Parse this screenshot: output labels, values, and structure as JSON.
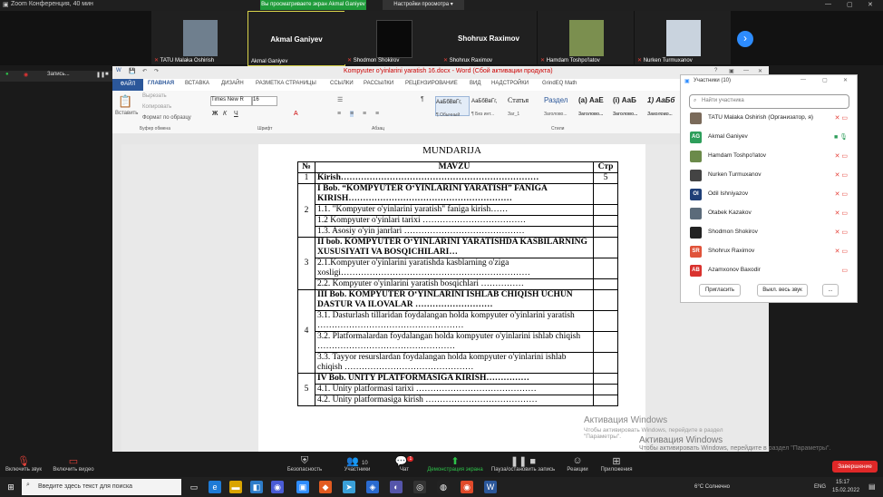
{
  "zoom": {
    "title": "Zoom Конференция, 40 мин",
    "view_banner": "Вы просматриваете экран Akmal Ganiyev",
    "view_settings": "Настройки просмотра ▾",
    "recording_label": "Запись...",
    "tiles": [
      {
        "mini_name": "TATU Malaka Oshirish",
        "big_name": ""
      },
      {
        "mini_name": "Akmal Ganiyev",
        "big_name": "Akmal Ganiyev"
      },
      {
        "mini_name": "Shodmon Shokirov",
        "big_name": ""
      },
      {
        "mini_name": "Shohrux Raximov",
        "big_name": "Shohrux Raximov"
      },
      {
        "mini_name": "Hamdam Toshpo'latov",
        "big_name": ""
      },
      {
        "mini_name": "Nurken Turmuxanov",
        "big_name": ""
      }
    ],
    "toolbar": {
      "audio": "Включить звук",
      "video": "Включить видео",
      "security": "Безопасность",
      "participants": "Участники",
      "participants_count": "10",
      "chat": "Чат",
      "chat_badge": "1",
      "share": "Демонстрация экрана",
      "pause_rec": "Пауза/остановить запись",
      "reactions": "Реакции",
      "apps": "Приложения",
      "end": "Завершение"
    }
  },
  "word": {
    "title": "Kompyuter o'yinlarini yaratish 16.docx - Word (Сбой активации продукта)",
    "tabs": [
      "ФАЙЛ",
      "ГЛАВНАЯ",
      "ВСТАВКА",
      "ДИЗАЙН",
      "РАЗМЕТКА СТРАНИЦЫ",
      "ССЫЛКИ",
      "РАССЫЛКИ",
      "РЕЦЕНЗИРОВАНИЕ",
      "ВИД",
      "НАДСТРОЙКИ",
      "GrindEQ Math"
    ],
    "ribbon": {
      "paste": "Вставить",
      "cut": "Вырезать",
      "copy": "Копировать",
      "format_painter": "Формат по образцу",
      "clipboard": "Буфер обмена",
      "font_name": "Times New R",
      "font_size": "16",
      "font_group": "Шрифт",
      "paragraph_group": "Абзац",
      "styles_group": "Стили",
      "styles": [
        {
          "preview": "АаБбВвГг,",
          "label": "¶ Обычный"
        },
        {
          "preview": "АаБбВвГг,",
          "label": "¶ Без инт..."
        },
        {
          "preview": "Статья",
          "label": "Заг_1"
        },
        {
          "preview": "Раздел",
          "label": "Заголово..."
        },
        {
          "preview": "(a)  АаЕ",
          "label": "Заголово..."
        },
        {
          "preview": "(i)  АаБ",
          "label": "Заголово..."
        },
        {
          "preview": "1)  АаБб",
          "label": "Заголово..."
        }
      ]
    },
    "doc": {
      "heading": "MUNDARIJA",
      "col_no": "№",
      "col_mavzu": "MAVZU",
      "col_page": "Стр",
      "rows": {
        "kirish_no": "1",
        "kirish": "Kirish……………………………………………………………",
        "kirish_page": "5",
        "ch2_no": "2",
        "ch2_title": "I Bob. “KOMPYUTER O‘YINLARINI YARATISH” FANIGA KIRISH…………………………………………………",
        "ch2_1": "1.1. \"Kompyuter o'yinlarini yaratish\" faniga kirish……",
        "ch2_2": "1.2 Kompyuter o'yinlari tarixi ………………………………",
        "ch2_3": "1.3. Asosiy o'yin janrlari ……………………………………",
        "ch3_no": "3",
        "ch3_title": "II bob.  KOMPYUTER O‘YINLARINI YARATISHDA KASBILARNING XUSUSIYATI VA BOSQICHILARI…",
        "ch3_1": "2.1.Kompyuter o'yinlarini yaratishda kasblarning o'ziga xosligi…………………………………………………………",
        "ch3_2": "2.2. Kompyuter o'yinlarini yaratish bosqichlari ……………",
        "ch4_no": "4",
        "ch4_title": "III Bob. KOMPYUTER O‘YINLARINI ISHLAB CHIQISH UCHUN DASTUR VA ILOVALAR ………………………",
        "ch4_1": "3.1. Dasturlash tillaridan foydalangan holda kompyuter o'yinlarini yaratish ……………………………………………",
        "ch4_2": "3.2. Platformalardan foydalangan holda kompyuter o'yinlarini ishlab chiqish …………………………………………",
        "ch4_3": "3.3. Tayyor resurslardan foydalangan holda kompyuter o'yinlarini ishlab chiqish ………………………………………",
        "ch5_no": "5",
        "ch5_title": "IV Bob. UNITY PLATFORMASIGA KIRISH……………",
        "ch5_1": "4.1. Unity platformasi tarixi ……………………………………",
        "ch5_2": "4.2. Unity platformasiga kirish …………………………………"
      }
    },
    "activation_title": "Активация Windows",
    "activation_text": "Чтобы активировать Windows, перейдите в раздел \"Параметры\"."
  },
  "participants_panel": {
    "title": "Участники (10)",
    "search_placeholder": "Найти участника",
    "list": [
      {
        "initials": "",
        "name": "TATU Malaka Oshirish (Организатор, я)",
        "color": "#7a6a5a"
      },
      {
        "initials": "AG",
        "name": "Akmal Ganiyev",
        "color": "#2e9e5b"
      },
      {
        "initials": "",
        "name": "Hamdam Toshpo'latov",
        "color": "#6b8a4a"
      },
      {
        "initials": "",
        "name": "Nurken Turmuxanov",
        "color": "#444"
      },
      {
        "initials": "OI",
        "name": "Odil Ishniyazov",
        "color": "#1f3f77"
      },
      {
        "initials": "",
        "name": "Otabek Kazakov",
        "color": "#5b6b7a"
      },
      {
        "initials": "",
        "name": "Shodmon Shokirov",
        "color": "#222"
      },
      {
        "initials": "SR",
        "name": "Shohrux Raximov",
        "color": "#e0533a"
      },
      {
        "initials": "AB",
        "name": "Azamxonov Baxodir",
        "color": "#d9322e"
      }
    ],
    "invite": "Пригласить",
    "mute_all": "Выкл. весь звук",
    "more": "..."
  },
  "desktop": {
    "watermark_title": "Активация Windows",
    "watermark_text": "Чтобы активировать Windows, перейдите в раздел \"Параметры\"."
  },
  "taskbar": {
    "search_placeholder": "Введите здесь текст для поиска",
    "weather": "6°C  Солнечно",
    "lang": "ENG",
    "time": "15:17",
    "date": "15.02.2022"
  }
}
